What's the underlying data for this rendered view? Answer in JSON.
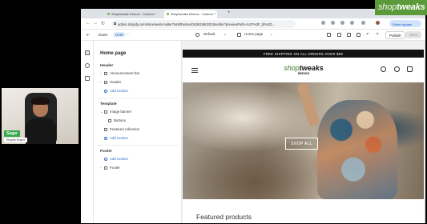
{
  "brand_overlay": {
    "part1": "shop",
    "part2": "tweaks"
  },
  "webcam": {
    "name": "Sagar",
    "role": "Shopify Expert"
  },
  "browser": {
    "tabs": [
      {
        "label": "Shoptweaks Demos · Custom"
      },
      {
        "label": "Shoptweaks Demos · Custom"
      }
    ],
    "address": "admin.shopify.com/store/west-muller7646/themes/163618602015/editor?previewPath=%2F%3F_bt%3D...",
    "finish_update": "Finish update"
  },
  "editor": {
    "topbar": {
      "exit": "⇤",
      "theme_name": "Dawn",
      "status": "Draft",
      "more": "···",
      "store_ctl": "Default",
      "page_ctl": "Home page",
      "publish": "Publish",
      "save": "Save"
    },
    "sidebar": {
      "title": "Home page",
      "groups": [
        {
          "label": "Header"
        },
        {
          "label": "Template"
        },
        {
          "label": "Footer"
        }
      ],
      "header_items": [
        "Announcement bar",
        "Header"
      ],
      "template_items": [
        "Image banner",
        "Buttons",
        "Featured collection"
      ],
      "footer_items": [
        "Footer"
      ],
      "add_section": "Add section"
    }
  },
  "store": {
    "announcement": "FREE SHIPPING ON ALL ORDERS OVER $99",
    "logo_part1": "shop",
    "logo_part2": "tweaks",
    "logo_sub": "demos",
    "banner_button": "SHOP ALL",
    "featured_heading": "Featured products"
  }
}
